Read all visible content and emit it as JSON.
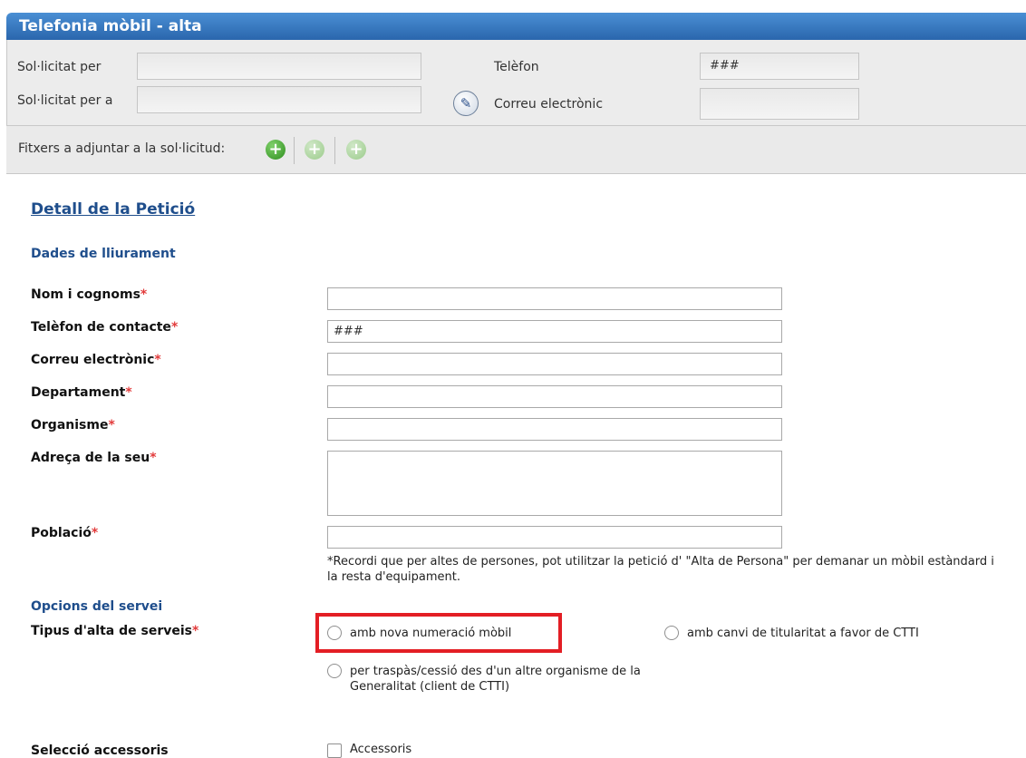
{
  "window": {
    "title": "Telefonia mòbil - alta"
  },
  "header": {
    "requested_by_label": "Sol·licitat per",
    "requested_by_value": "",
    "requested_for_label": "Sol·licitat per a",
    "requested_for_value": "",
    "phone_label": "Telèfon",
    "phone_value": "###",
    "email_label": "Correu electrònic",
    "email_value": ""
  },
  "attachments": {
    "label": "Fitxers a adjuntar a la sol·licitud:"
  },
  "detail": {
    "title": "Detall de la Petició",
    "delivery_title": "Dades de lliurament",
    "fields": {
      "name": {
        "label": "Nom i cognoms",
        "value": ""
      },
      "contact_phone": {
        "label": "Telèfon de contacte",
        "value": "###"
      },
      "email": {
        "label": "Correu electrònic",
        "value": ""
      },
      "department": {
        "label": "Departament",
        "value": ""
      },
      "organism": {
        "label": "Organisme",
        "value": ""
      },
      "address": {
        "label": "Adreça de la seu",
        "value": ""
      },
      "city": {
        "label": "Població",
        "value": ""
      }
    },
    "required_mark": "*",
    "note": "*Recordi que per altes de persones, pot utilitzar la petició d' \"Alta de Persona\" per demanar un mòbil estàndard i la resta d'equipament."
  },
  "service": {
    "title": "Opcions del servei",
    "type_label": "Tipus d'alta de serveis",
    "options": [
      "amb nova numeració mòbil",
      "amb canvi de titularitat a favor de CTTI",
      "per traspàs/cessió des d'un altre organisme de la Generalitat (client de CTTI)"
    ],
    "accessories_label": "Selecció accessoris",
    "accessories_checkbox": "Accessoris"
  },
  "colors": {
    "title_bar": "#2a66ad",
    "section_title": "#1f4e8c",
    "required": "#e23b3b",
    "highlight": "#e31e24",
    "add_icon": "#2f8f1f"
  }
}
